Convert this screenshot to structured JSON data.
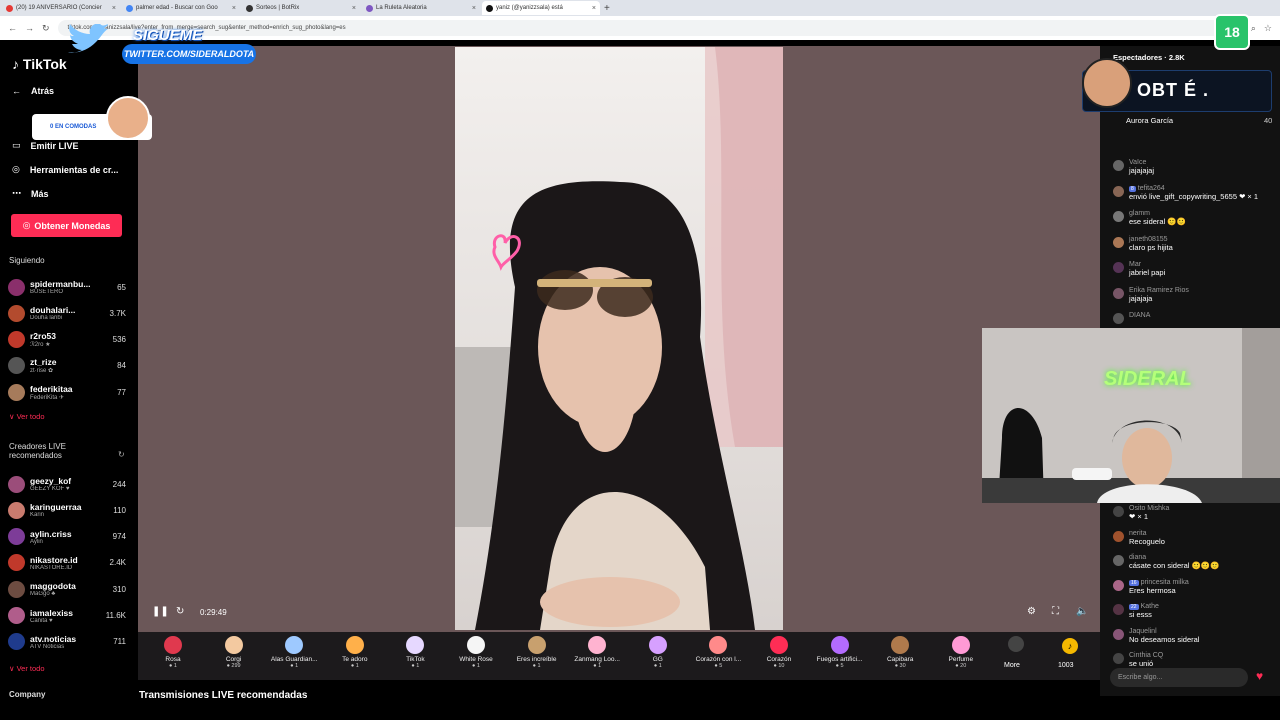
{
  "browser": {
    "tabs": [
      {
        "label": "(20) 19 ANIVERSARIO (Concier",
        "color": "#e53935"
      },
      {
        "label": "palmer edad - Buscar con Goo",
        "color": "#4285f4"
      },
      {
        "label": "Sorteos | BotRix",
        "color": "#333333"
      },
      {
        "label": "La Ruleta Aleatoria",
        "color": "#7e57c2"
      },
      {
        "label": "yaniz (@yanizzsala) está",
        "color": "#111111"
      }
    ],
    "url": "tiktok.com/@yanizzsala/live?enter_from_merge=search_sug&enter_method=enrich_sug_photo&lang=es"
  },
  "sidebar": {
    "logo": "TikTok",
    "back": "Atrás",
    "live": "Emitir LIVE",
    "tools": "Herramientas de cr...",
    "more": "Más",
    "coins_button": "Obtener Monedas",
    "following_title": "Siguiendo",
    "following": [
      {
        "name": "spidermanbu...",
        "sub": "BUSETERO",
        "count": "65",
        "color": "#8a2f6b"
      },
      {
        "name": "douhalari...",
        "sub": "Douha laribi",
        "count": "3.7K",
        "color": "#b34b2e"
      },
      {
        "name": "r2ro53",
        "sub": "ℛ2ro ★",
        "count": "536",
        "color": "#c0392b"
      },
      {
        "name": "zt_rize",
        "sub": "zt·rise ✿",
        "count": "84",
        "color": "#555555"
      },
      {
        "name": "federikitaa",
        "sub": "FederiKita ✈",
        "count": "77",
        "color": "#a67b5b"
      }
    ],
    "see_all": "∨ Ver todo",
    "recommended_title_1": "Creadores LIVE",
    "recommended_title_2": "recomendados",
    "recommended": [
      {
        "name": "geezy_kof",
        "sub": "GEEZY KOF ♥",
        "count": "244",
        "color": "#9b4d7a"
      },
      {
        "name": "karinguerraa",
        "sub": "Karin",
        "count": "110",
        "color": "#c97b6e"
      },
      {
        "name": "aylin.criss",
        "sub": "Aylin",
        "count": "974",
        "color": "#7d3c98"
      },
      {
        "name": "nikastore.id",
        "sub": "NIKASTORE.ID",
        "count": "2.4K",
        "color": "#c0392b"
      },
      {
        "name": "maggodota",
        "sub": "MaGgo ♣",
        "count": "310",
        "color": "#6d4c41"
      },
      {
        "name": "iamalexiss",
        "sub": "Cañita ♥",
        "count": "11.6K",
        "color": "#b05d8b"
      },
      {
        "name": "atv.noticias",
        "sub": "ATV Noticias",
        "count": "711",
        "color": "#1f3b8c"
      }
    ],
    "see_all_2": "∨ Ver todo",
    "company": "Company"
  },
  "overlay": {
    "sigueme": "SIGUEME",
    "twitter": "TWITTER.COM/SIDERALDOTA",
    "coins_text": "0 EN COMODAS",
    "obt_text": "OBT É .",
    "badge": "18",
    "watermark": "SIDERAL"
  },
  "player": {
    "time": "0:29:49"
  },
  "gifts": [
    {
      "name": "Rosa",
      "price": "1",
      "color": "#e0394e"
    },
    {
      "name": "Corgi",
      "price": "299",
      "color": "#f3c9a0"
    },
    {
      "name": "Alas Guardian...",
      "price": "1",
      "color": "#9ec9ff"
    },
    {
      "name": "Te adoro",
      "price": "1",
      "color": "#ffb04a"
    },
    {
      "name": "TikTok",
      "price": "1",
      "color": "#e6d8ff"
    },
    {
      "name": "White Rose",
      "price": "1",
      "color": "#f5f5f5"
    },
    {
      "name": "Eres increíble",
      "price": "1",
      "color": "#c8a06e"
    },
    {
      "name": "Zanmang Loo...",
      "price": "1",
      "color": "#ffb3d0"
    },
    {
      "name": "GG",
      "price": "1",
      "color": "#d6a0ff"
    },
    {
      "name": "Corazón con l...",
      "price": "5",
      "color": "#ff8a8a"
    },
    {
      "name": "Corazón",
      "price": "10",
      "color": "#ff2d55"
    },
    {
      "name": "Fuegos artifici...",
      "price": "5",
      "color": "#b36bff"
    },
    {
      "name": "Capibara",
      "price": "30",
      "color": "#b07a4c"
    },
    {
      "name": "Perfume",
      "price": "20",
      "color": "#ff9ad5"
    }
  ],
  "gift_more": "More",
  "coin_balance": "1003",
  "recommended_section": "Transmisiones LIVE recomendadas",
  "chat": {
    "viewers_label": "Espectadores · 2.8K",
    "top_viewer": "Aurora García",
    "top_viewer_score": "40",
    "messages": [
      {
        "user": "Vaïce",
        "badge": "",
        "text": "jajajajaj",
        "color": "#666666"
      },
      {
        "user": "tefita264",
        "badge": "8",
        "text": "envió live_gift_copywriting_5655 ❤ × 1",
        "color": "#886655"
      },
      {
        "user": "glamm",
        "badge": "",
        "text": "ese sideral 🙂🙂",
        "color": "#777777"
      },
      {
        "user": "janeth08155",
        "badge": "",
        "text": "claro ps hijita",
        "color": "#aa7755"
      },
      {
        "user": "Mar",
        "badge": "",
        "text": "jabriel papi",
        "color": "#553355"
      },
      {
        "user": "Erika Ramirez Rios",
        "badge": "",
        "text": "jajajaja",
        "color": "#775566"
      },
      {
        "user": "DIANA",
        "badge": "",
        "text": "",
        "color": "#555555"
      }
    ],
    "messages_lower": [
      {
        "user": "Osito Mishka",
        "badge": "",
        "text": "❤ × 1",
        "color": "#444444"
      },
      {
        "user": "nerita",
        "badge": "",
        "text": "Recoguelo",
        "color": "#a0522d"
      },
      {
        "user": "diana",
        "badge": "",
        "text": "cásate con sideral 🙂🙂🙂",
        "color": "#666666"
      },
      {
        "user": "princesita milka",
        "badge": "16",
        "text": "Eres hermosa",
        "color": "#aa6688"
      },
      {
        "user": "Kathe",
        "badge": "22",
        "text": "si esss",
        "color": "#553344"
      },
      {
        "user": "Jaquelinl",
        "badge": "",
        "text": "No deseamos sideral",
        "color": "#885577"
      },
      {
        "user": "Cinthia CQ",
        "badge": "",
        "text": "se unió",
        "color": "#444444"
      }
    ],
    "input_placeholder": "Escribe algo..."
  }
}
